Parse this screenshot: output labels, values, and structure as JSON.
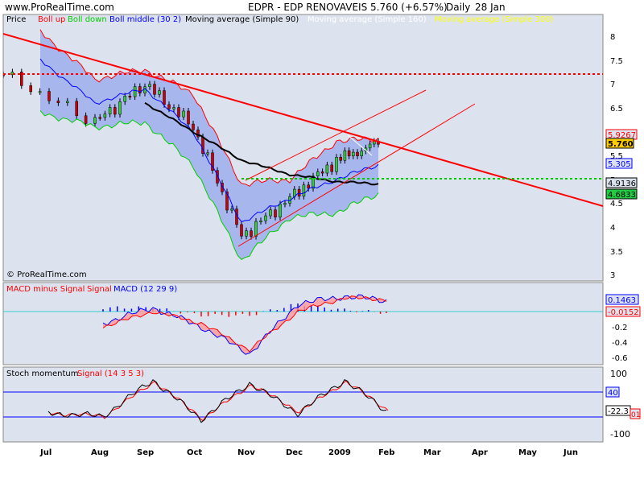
{
  "header": {
    "site": "www.ProRealTime.com",
    "instrument": "EDPR - EDP RENOVAVEIS",
    "price_change": "5.760 (+6.57%)",
    "period": "Daily",
    "date": "28 Jan"
  },
  "price_panel": {
    "legend": [
      {
        "label": "Price",
        "color": "#000000"
      },
      {
        "label": "Boll up",
        "color": "#ff0000"
      },
      {
        "label": "Boll down",
        "color": "#00cc00"
      },
      {
        "label": "Boll middle (30 2)",
        "color": "#0000ff"
      },
      {
        "label": "Moving average (Simple 90)",
        "color": "#000000"
      },
      {
        "label": "Moving average (Simple 160)",
        "color": "#ffffff"
      },
      {
        "label": "Moving average (Simple 300)",
        "color": "#ffff00"
      }
    ],
    "watermark": "© ProRealTime.com",
    "y_ticks": [
      "8",
      "7.5",
      "7",
      "6.5",
      "6",
      "5.5",
      "5",
      "4.5",
      "4",
      "3.5",
      "3"
    ],
    "value_tags": [
      {
        "text": "5.9267",
        "value": 5.9267,
        "color": "#ff0000",
        "bg": "#dde3ee"
      },
      {
        "text": "5.760",
        "value": 5.76,
        "color": "#000000",
        "bg": "#ffcc00"
      },
      {
        "text": "5.305",
        "value": 5.305,
        "color": "#0000ff",
        "bg": "#dde3ee"
      },
      {
        "text": "4.9136",
        "value": 4.9136,
        "color": "#000000",
        "bg": "#dde3ee"
      },
      {
        "text": "4.6833",
        "value": 4.6833,
        "color": "#000000",
        "bg": "#22cc44"
      }
    ]
  },
  "macd_panel": {
    "legend": [
      {
        "label": "MACD minus Signal",
        "color": "#ff0000"
      },
      {
        "label": "Signal",
        "color": "#ff0000"
      },
      {
        "label": "MACD (12 29 9)",
        "color": "#0000ff"
      }
    ],
    "y_ticks": [
      "-0.2",
      "-0.4",
      "-0.6"
    ],
    "value_tags": [
      {
        "text": "0.1463",
        "color": "#0000ff"
      },
      {
        "text": "-0.0152",
        "color": "#ff0000"
      }
    ]
  },
  "stoch_panel": {
    "legend": [
      {
        "label": "Stoch momentum",
        "color": "#000000"
      },
      {
        "label": "Signal (14 3 5 3)",
        "color": "#ff0000"
      }
    ],
    "y_ticks": [
      "100",
      "-100"
    ],
    "value_tags": [
      {
        "text": "40",
        "color": "#0000ff"
      },
      {
        "text": "-22.3",
        "color": "#000000"
      },
      {
        "text": "01",
        "color": "#ff0000"
      }
    ]
  },
  "x_axis": {
    "labels": [
      "Jul",
      "Aug",
      "Sep",
      "Oct",
      "Nov",
      "Dec",
      "2009",
      "Feb",
      "Mar",
      "Apr",
      "May",
      "Jun"
    ]
  },
  "chart_data": [
    {
      "type": "line",
      "title": "EDPR - EDP RENOVAVEIS",
      "subtitle": "5.760 (+6.57%) Daily 28 Jan",
      "x": [
        "Jul",
        "Aug",
        "Sep",
        "Oct",
        "Nov",
        "Dec",
        "2009",
        "Feb"
      ],
      "ylim": [
        2.9,
        8.3
      ],
      "series": [
        {
          "name": "Price",
          "values": [
            7.2,
            6.2,
            7.0,
            6.1,
            3.8,
            4.6,
            5.4,
            5.76
          ]
        },
        {
          "name": "Boll up",
          "values": [
            8.1,
            7.1,
            7.3,
            6.8,
            4.9,
            5.0,
            5.8,
            5.85
          ]
        },
        {
          "name": "Boll down",
          "values": [
            6.4,
            6.1,
            6.2,
            5.3,
            3.3,
            4.2,
            4.3,
            4.7
          ]
        },
        {
          "name": "Boll middle (30 2)",
          "values": [
            7.5,
            6.6,
            6.9,
            6.0,
            4.1,
            4.6,
            5.0,
            5.3
          ]
        },
        {
          "name": "Moving average (Simple 90)",
          "values": [
            null,
            null,
            6.6,
            6.0,
            5.4,
            5.1,
            4.95,
            4.9
          ]
        }
      ],
      "annotations": [
        {
          "type": "horizontal-line",
          "value": 7.23,
          "color": "#ff0000"
        },
        {
          "type": "horizontal-line",
          "value": 5.0,
          "color": "#00cc00"
        }
      ]
    },
    {
      "type": "bar",
      "title": "MACD minus Signal Signal MACD (12 29 9)",
      "x": [
        "Jul",
        "Aug",
        "Sep",
        "Oct",
        "Nov",
        "Dec",
        "2009",
        "Feb"
      ],
      "ylim": [
        -0.7,
        0.25
      ],
      "series": [
        {
          "name": "MACD (12 29 9)",
          "values": [
            null,
            -0.15,
            0.05,
            -0.2,
            -0.55,
            0.1,
            0.2,
            0.1463
          ]
        },
        {
          "name": "Signal",
          "values": [
            null,
            -0.2,
            0.0,
            -0.15,
            -0.5,
            0.0,
            0.18,
            0.16
          ]
        },
        {
          "name": "MACD minus Signal",
          "values": [
            null,
            0.05,
            0.05,
            -0.05,
            -0.05,
            0.1,
            0.02,
            -0.0152
          ]
        }
      ]
    },
    {
      "type": "line",
      "title": "Stoch momentum Signal (14 3 5 3)",
      "x": [
        "Jul",
        "Aug",
        "Sep",
        "Oct",
        "Nov",
        "Dec",
        "2009",
        "Feb"
      ],
      "ylim": [
        -110,
        110
      ],
      "series": [
        {
          "name": "Stoch momentum",
          "values": [
            -30,
            -40,
            80,
            -50,
            70,
            -30,
            80,
            -22.3
          ]
        },
        {
          "name": "Signal (14 3 5 3)",
          "values": [
            -30,
            -40,
            75,
            -48,
            65,
            -25,
            75,
            -20
          ]
        }
      ],
      "annotations": [
        {
          "type": "horizontal-line",
          "value": 40,
          "color": "#0000ff"
        },
        {
          "type": "horizontal-line",
          "value": -40,
          "color": "#0000ff"
        }
      ]
    }
  ]
}
